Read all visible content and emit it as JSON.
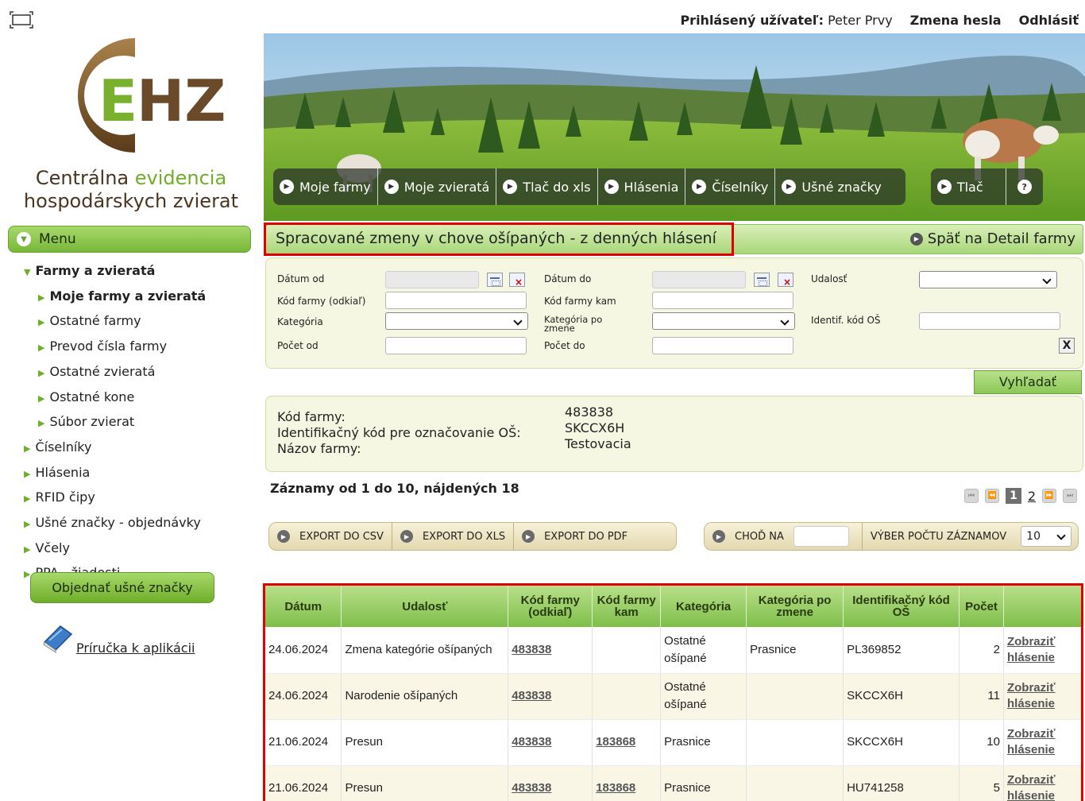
{
  "header": {
    "user_label": "Prihlásený užívateľ:",
    "user_name": "Peter Prvy",
    "change_password": "Zmena hesla",
    "logout": "Odhlásiť"
  },
  "logo": {
    "letters": "EHZ",
    "line1_prefix": "Centrálna",
    "line1_green": "evidencia",
    "line2": "hospodárskych zvierat"
  },
  "menu": {
    "title": "Menu",
    "items": [
      {
        "label": "Farmy a zvieratá",
        "level": 0,
        "bold": true,
        "expanded": true
      },
      {
        "label": "Moje farmy a zvieratá",
        "level": 1,
        "bold": true
      },
      {
        "label": "Ostatné farmy",
        "level": 1
      },
      {
        "label": "Prevod čísla farmy",
        "level": 1
      },
      {
        "label": "Ostatné zvieratá",
        "level": 1
      },
      {
        "label": "Ostatné kone",
        "level": 1
      },
      {
        "label": "Súbor zvierat",
        "level": 1
      },
      {
        "label": "Číselníky",
        "level": 0
      },
      {
        "label": "Hlásenia",
        "level": 0
      },
      {
        "label": "RFID čipy",
        "level": 0
      },
      {
        "label": "Ušné značky - objednávky",
        "level": 0
      },
      {
        "label": "Včely",
        "level": 0
      },
      {
        "label": "PPA - žiadosti",
        "level": 0
      }
    ],
    "order_button": "Objednať ušné značky",
    "manual_link": "Príručka k aplikácii"
  },
  "topnav": {
    "items": [
      "Moje farmy",
      "Moje zvieratá",
      "Tlač do xls",
      "Hlásenia",
      "Číselníky",
      "Ušné značky"
    ],
    "print": "Tlač",
    "help_icon": "question-icon"
  },
  "page": {
    "title": "Spracované zmeny v chove ošípaných - z denných hlásení",
    "back_link": "Späť na Detail farmy"
  },
  "filter": {
    "date_from": "Dátum od",
    "date_to": "Dátum do",
    "event": "Udalosť",
    "farm_from": "Kód farmy (odkiaľ)",
    "farm_to": "Kód farmy kam",
    "category": "Kategória",
    "category_after": "Kategória po zmene",
    "ident_code": "Identif. kód OŠ",
    "count_from": "Počet od",
    "count_to": "Počet do",
    "clear": "X",
    "search_button": "Vyhľadať"
  },
  "farm_info": {
    "code_label": "Kód farmy:",
    "ident_label": "Identifikačný kód pre označovanie OŠ:",
    "name_label": "Názov farmy:",
    "code_value": "483838",
    "ident_value": "SKCCX6H",
    "name_value": "Testovacia"
  },
  "records": {
    "summary": "Záznamy od 1 do 10, nájdených 18",
    "current_page": "1",
    "next_page": "2"
  },
  "export": {
    "csv": "EXPORT DO CSV",
    "xls": "EXPORT DO XLS",
    "pdf": "EXPORT DO PDF",
    "goto": "CHOĎ NA",
    "page_size_label": "VÝBER POČTU ZÁZNAMOV",
    "page_size_value": "10"
  },
  "table": {
    "columns": [
      "Dátum",
      "Udalosť",
      "Kód farmy (odkiaľ)",
      "Kód farmy kam",
      "Kategória",
      "Kategória po zmene",
      "Identifikačný kód OŠ",
      "Počet",
      ""
    ],
    "rows": [
      {
        "date": "24.06.2024",
        "event": "Zmena kategórie ošípaných",
        "from": "483838",
        "to": "",
        "category": "Ostatné ošípané",
        "category_after": "Prasnice",
        "ident": "PL369852",
        "count": "2",
        "action1": "Zobraziť",
        "action2": "hlásenie"
      },
      {
        "date": "24.06.2024",
        "event": "Narodenie ošípaných",
        "from": "483838",
        "to": "",
        "category": "Ostatné ošípané",
        "category_after": "",
        "ident": "SKCCX6H",
        "count": "11",
        "action1": "Zobraziť",
        "action2": "hlásenie"
      },
      {
        "date": "21.06.2024",
        "event": "Presun",
        "from": "483838",
        "to": "183868",
        "category": "Prasnice",
        "category_after": "",
        "ident": "SKCCX6H",
        "count": "10",
        "action1": "Zobraziť",
        "action2": "hlásenie"
      },
      {
        "date": "21.06.2024",
        "event": "Presun",
        "from": "483838",
        "to": "183868",
        "category": "Prasnice",
        "category_after": "",
        "ident": "HU741258",
        "count": "5",
        "action1": "Zobraziť",
        "action2": "hlásenie"
      }
    ]
  },
  "colors": {
    "accent_green": "#8cc358",
    "highlight_red": "#e00000",
    "panel_bg": "#f5f7e2"
  }
}
